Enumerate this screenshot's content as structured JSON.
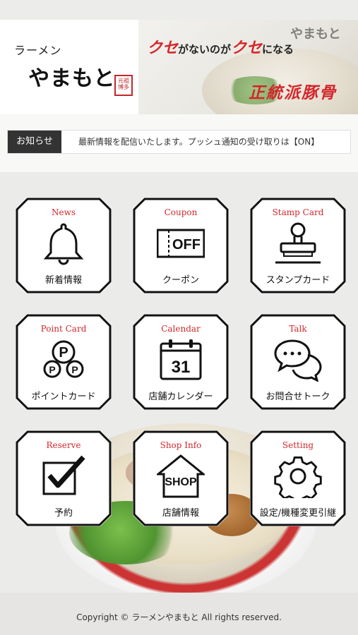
{
  "header": {
    "brand_sub": "ラーメン",
    "brand_main": "やまもと",
    "seal_text": "元祖博多",
    "banner_brand": "やまもと",
    "slogan_part1": "クセ",
    "slogan_part2": "がないのが",
    "slogan_part3": "クセ",
    "slogan_part4": "になる",
    "slogan_line2": "正統派豚骨"
  },
  "notice": {
    "label": "お知らせ",
    "text": "最新情報を配信いたします。プッシュ通知の受け取りは【ON】"
  },
  "tiles": [
    {
      "en": "News",
      "ja": "新着情報",
      "icon": "bell-icon"
    },
    {
      "en": "Coupon",
      "ja": "クーポン",
      "icon": "coupon-off-icon",
      "icon_text": "OFF"
    },
    {
      "en": "Stamp Card",
      "ja": "スタンプカード",
      "icon": "stamp-icon"
    },
    {
      "en": "Point Card",
      "ja": "ポイントカード",
      "icon": "points-icon",
      "icon_text": "P"
    },
    {
      "en": "Calendar",
      "ja": "店舗カレンダー",
      "icon": "calendar-icon",
      "icon_text": "31"
    },
    {
      "en": "Talk",
      "ja": "お問合せトーク",
      "icon": "chat-bubbles-icon"
    },
    {
      "en": "Reserve",
      "ja": "予約",
      "icon": "checkbox-icon"
    },
    {
      "en": "Shop Info",
      "ja": "店舗情報",
      "icon": "shop-house-icon",
      "icon_text": "SHOP"
    },
    {
      "en": "Setting",
      "ja": "設定/機種変更引継",
      "icon": "gear-icon"
    }
  ],
  "footer": {
    "copyright": "Copyright © ラーメンやまもと All rights reserved."
  },
  "colors": {
    "accent_red": "#d3262a",
    "tile_border": "#111111",
    "notice_label_bg": "#333333"
  }
}
